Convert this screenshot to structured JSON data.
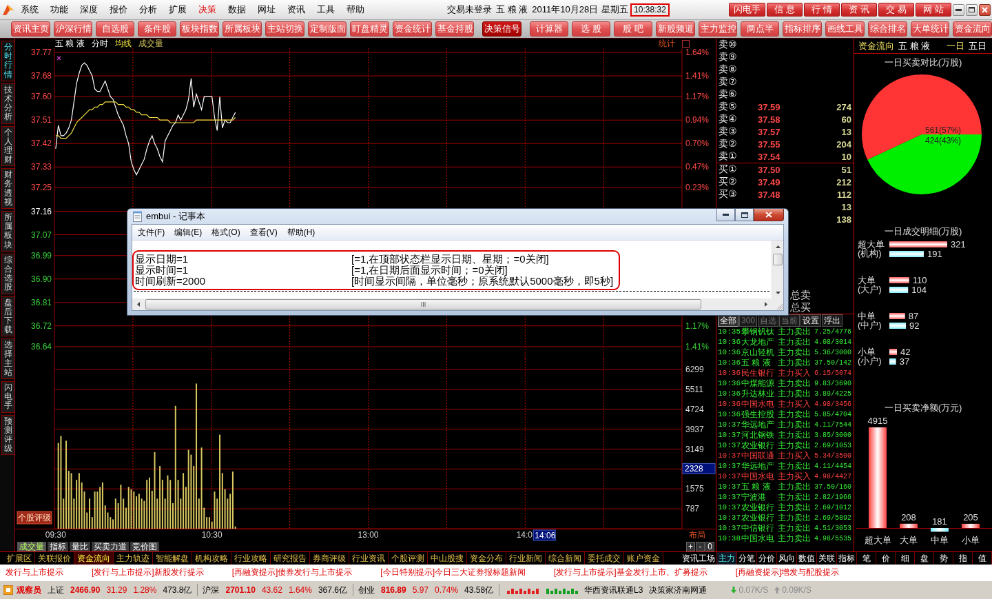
{
  "menu_bar": {
    "items": [
      {
        "label": "系统",
        "selected": false
      },
      {
        "label": "功能",
        "selected": false
      },
      {
        "label": "深度",
        "selected": false
      },
      {
        "label": "报价",
        "selected": false
      },
      {
        "label": "分析",
        "selected": false
      },
      {
        "label": "扩展",
        "selected": false
      },
      {
        "label": "决策",
        "selected": true
      },
      {
        "label": "数据",
        "selected": false
      },
      {
        "label": "网址",
        "selected": false
      },
      {
        "label": "资讯",
        "selected": false
      },
      {
        "label": "工具",
        "selected": false
      },
      {
        "label": "帮助",
        "selected": false
      }
    ],
    "login_status": "交易未登录",
    "stock": "五 粮 液",
    "date": "2011年10月28日",
    "weekday": "星期五",
    "clock": "10:38:32",
    "clock_highlighted": true,
    "buttons": [
      "闪电手",
      "信 息",
      "行 情",
      "资 讯",
      "交 易",
      "网 站"
    ]
  },
  "toolbar": [
    {
      "label": "资讯主页",
      "selected": false
    },
    {
      "label": "沪深行情",
      "selected": false
    },
    {
      "label": "自选股",
      "selected": false
    },
    {
      "label": "条件股",
      "selected": false
    },
    {
      "label": "板块指数",
      "selected": false
    },
    {
      "label": "所属板块",
      "selected": false
    },
    {
      "label": "主站切换",
      "selected": false
    },
    {
      "label": "定制版面",
      "selected": false
    },
    {
      "label": "盯盘精灵",
      "selected": false
    },
    {
      "label": "资金统计",
      "selected": false
    },
    {
      "label": "基金持股",
      "selected": false
    },
    {
      "label": "决策信号",
      "selected": true
    },
    {
      "label": "计算器",
      "selected": false
    },
    {
      "label": "选 股",
      "selected": false
    },
    {
      "label": "股 吧",
      "selected": false
    },
    {
      "label": "新股频道",
      "selected": false
    },
    {
      "label": "主力监控",
      "selected": false
    },
    {
      "label": "两点半",
      "selected": false
    },
    {
      "label": "指标排序",
      "selected": false
    },
    {
      "label": "画线工具",
      "selected": false
    },
    {
      "label": "综合排名",
      "selected": false
    },
    {
      "label": "大单统计",
      "selected": false
    },
    {
      "label": "资金流向",
      "selected": false
    }
  ],
  "side_tabs": [
    {
      "label": "分时行情",
      "selected": true
    },
    {
      "label": "技术分析",
      "selected": false
    },
    {
      "label": "个人理财",
      "selected": false
    },
    {
      "label": "财务透视",
      "selected": false
    },
    {
      "label": "所属板块",
      "selected": false
    },
    {
      "label": "综合选股",
      "selected": false
    },
    {
      "label": "盘后下载",
      "selected": false
    },
    {
      "label": "选择主站",
      "selected": false
    },
    {
      "label": "闪电手",
      "selected": false
    },
    {
      "label": "预测评级",
      "selected": false
    }
  ],
  "chart": {
    "stock": "五 粮 液",
    "stats_label": "统计",
    "price_chart": {
      "chart_data": {
        "type": "line",
        "grid": true,
        "categories": [
          null,
          null,
          null,
          null,
          null,
          null,
          null,
          null,
          null,
          null,
          null,
          null,
          null,
          null,
          null,
          null,
          null,
          null,
          null,
          null,
          null,
          null,
          null,
          null,
          null,
          null,
          null,
          null,
          null,
          null,
          null,
          null,
          null,
          null,
          null,
          null,
          null,
          null,
          null,
          null,
          null,
          null,
          null,
          null,
          null,
          null,
          null,
          null,
          null,
          null,
          null,
          null,
          null,
          null,
          null,
          null,
          null,
          null,
          null,
          null,
          null,
          null,
          null,
          null,
          null,
          null,
          null,
          null,
          null,
          null,
          null,
          null,
          null,
          null,
          null,
          null,
          null,
          null,
          null,
          null,
          null,
          null,
          null,
          null,
          null,
          null,
          null,
          null,
          null,
          null,
          null,
          null,
          null,
          null,
          null,
          null,
          null,
          null,
          null,
          null,
          null,
          null,
          null,
          null,
          null,
          null,
          null,
          null,
          null,
          null,
          null,
          null,
          null,
          null,
          null,
          null,
          null,
          null,
          null,
          null,
          null,
          null,
          null,
          null,
          null,
          null,
          null,
          null,
          null,
          null,
          null,
          null,
          null,
          null,
          null,
          null,
          null,
          null,
          null,
          null,
          null,
          null,
          null,
          null,
          null,
          null,
          null,
          null,
          null,
          null,
          null,
          null,
          null,
          null,
          null,
          null,
          null,
          null,
          null,
          null,
          null,
          null,
          null,
          null,
          null,
          null,
          null,
          null,
          null,
          null,
          null,
          null,
          null,
          null,
          null,
          null,
          null,
          null,
          null,
          null,
          null,
          null,
          null,
          null,
          null,
          null,
          null,
          null,
          null,
          null,
          null,
          null,
          null,
          null,
          null,
          null,
          null,
          null,
          null,
          null,
          null,
          null,
          null,
          null,
          null,
          null,
          null,
          null,
          null,
          null,
          null,
          null,
          null,
          null,
          null,
          null,
          null,
          null,
          null,
          null,
          null,
          null,
          null,
          null,
          null,
          null,
          null,
          null,
          null,
          null,
          null,
          null,
          null,
          null,
          null,
          null,
          null,
          null,
          null,
          null,
          null
        ],
        "series": [
          {
            "name": "分时",
            "color": "#ffffff",
            "values": [
              37.4,
              37.49,
              37.45,
              37.45,
              37.46,
              37.48,
              37.51,
              37.58,
              37.65,
              37.69,
              37.72,
              37.73,
              37.72,
              37.7,
              37.68,
              37.63,
              37.62,
              37.62,
              37.64,
              37.66,
              37.63,
              37.6,
              37.59,
              37.56,
              37.53,
              37.51,
              37.49,
              37.45,
              37.42,
              37.35,
              37.32,
              37.3,
              37.32,
              37.34,
              37.36,
              37.4,
              37.43,
              37.45,
              37.42,
              37.4,
              37.37,
              37.35,
              37.43,
              37.45,
              37.47,
              37.49,
              37.5,
              37.53,
              37.51,
              37.53,
              37.55,
              37.59,
              37.67,
              37.56,
              37.61,
              37.58,
              37.55,
              37.6,
              37.6,
              37.6,
              37.6,
              37.52,
              37.47,
              37.6,
              37.48,
              37.51,
              37.5,
              37.5,
              37.52,
              37.54,
              null,
              null,
              null,
              null,
              null,
              null,
              null,
              null,
              null,
              null,
              null,
              null,
              null,
              null,
              null,
              null,
              null,
              null,
              null,
              null,
              null,
              null,
              null,
              null,
              null,
              null,
              null,
              null,
              null,
              null,
              null,
              null,
              null,
              null,
              null,
              null,
              null,
              null,
              null,
              null,
              null,
              null,
              null,
              null,
              null,
              null,
              null,
              null,
              null,
              null,
              null,
              null,
              null,
              null,
              null,
              null,
              null,
              null,
              null,
              null,
              null,
              null,
              null,
              null,
              null,
              null,
              null,
              null,
              null,
              null,
              null,
              null,
              null,
              null,
              null,
              null,
              null,
              null,
              null,
              null,
              null,
              null,
              null,
              null,
              null,
              null,
              null,
              null,
              null,
              null,
              null,
              null,
              null,
              null,
              null,
              null,
              null,
              null,
              null,
              null,
              null,
              null,
              null,
              null,
              null,
              null,
              null,
              null,
              null,
              null,
              null,
              null,
              null,
              null,
              null,
              null,
              null,
              null,
              null,
              null,
              null,
              null,
              null,
              null,
              null,
              null,
              null,
              null,
              null,
              null,
              null,
              null,
              null,
              null,
              null,
              null,
              null,
              null,
              null,
              null,
              null,
              null,
              null,
              null,
              null,
              null,
              null,
              null,
              null,
              null,
              null,
              null,
              null,
              null,
              null,
              null,
              null,
              null,
              null,
              null,
              null,
              null,
              null,
              null,
              null,
              null,
              null,
              null,
              null,
              null,
              null
            ]
          },
          {
            "name": "均线",
            "color": "#f0e040",
            "values": [
              37.45,
              37.45,
              37.44,
              37.44,
              37.44,
              37.45,
              37.46,
              37.48,
              37.5,
              37.51,
              37.52,
              37.53,
              37.54,
              37.55,
              37.55,
              37.56,
              37.56,
              37.57,
              37.57,
              37.58,
              37.58,
              37.58,
              37.58,
              37.58,
              37.57,
              37.57,
              37.57,
              37.56,
              37.56,
              37.55,
              37.55,
              37.54,
              37.54,
              37.53,
              37.53,
              37.53,
              37.52,
              37.52,
              37.52,
              37.52,
              37.51,
              37.51,
              37.51,
              37.51,
              37.5,
              37.5,
              37.5,
              37.5,
              37.5,
              37.5,
              37.5,
              37.5,
              37.5,
              37.5,
              37.51,
              37.51,
              37.51,
              37.51,
              37.51,
              37.51,
              37.51,
              37.51,
              37.51,
              37.51,
              37.51,
              37.51,
              37.51,
              37.51,
              37.51,
              37.52,
              null,
              null,
              null,
              null,
              null,
              null,
              null,
              null,
              null,
              null,
              null,
              null,
              null,
              null,
              null,
              null,
              null,
              null,
              null,
              null,
              null,
              null,
              null,
              null,
              null,
              null,
              null,
              null,
              null,
              null,
              null,
              null,
              null,
              null,
              null,
              null,
              null,
              null,
              null,
              null,
              null,
              null,
              null,
              null,
              null,
              null,
              null,
              null,
              null,
              null,
              null,
              null,
              null,
              null,
              null,
              null,
              null,
              null,
              null,
              null,
              null,
              null,
              null,
              null,
              null,
              null,
              null,
              null,
              null,
              null,
              null,
              null,
              null,
              null,
              null,
              null,
              null,
              null,
              null,
              null,
              null,
              null,
              null,
              null,
              null,
              null,
              null,
              null,
              null,
              null,
              null,
              null,
              null,
              null,
              null,
              null,
              null,
              null,
              null,
              null,
              null,
              null,
              null,
              null,
              null,
              null,
              null,
              null,
              null,
              null,
              null,
              null,
              null,
              null,
              null,
              null,
              null,
              null,
              null,
              null,
              null,
              null,
              null,
              null,
              null,
              null,
              null,
              null,
              null,
              null,
              null,
              null,
              null,
              null,
              null,
              null,
              null,
              null,
              null,
              null,
              null,
              null,
              null,
              null,
              null,
              null,
              null,
              null,
              null,
              null,
              null,
              null,
              null,
              null,
              null,
              null,
              null,
              null,
              null,
              null,
              null,
              null,
              null,
              null,
              null,
              null,
              null,
              null,
              null,
              null,
              null
            ]
          }
        ],
        "ylim": [
          36.64,
          37.77
        ],
        "yticks": [
          37.77,
          37.68,
          {
            "value": 37.6,
            "label": "37.60"
          },
          37.51,
          37.42,
          37.33,
          37.25,
          37.16,
          37.07,
          36.99,
          {
            "value": 36.9,
            "label": "36.90"
          },
          36.81,
          36.72,
          36.64
        ]
      }
    },
    "percent_labels_upper": [
      "1.64%",
      "1.41%",
      "1.17%",
      "0.94%",
      "0.70%",
      "0.47%",
      "0.23%"
    ],
    "percent_labels_lower": [
      "1.17%",
      "1.41%"
    ],
    "volume_chart": {
      "chart_data": {
        "type": "bar",
        "grid": true,
        "categories": [
          "09:30",
          null,
          null,
          null,
          null,
          null,
          null,
          null,
          null,
          null,
          null,
          null,
          null,
          null,
          null,
          null,
          null,
          null,
          null,
          null,
          null,
          null,
          null,
          null,
          null,
          null,
          null,
          null,
          null,
          null,
          null,
          null,
          null,
          null,
          null,
          null,
          null,
          null,
          null,
          null,
          null,
          null,
          null,
          null,
          null,
          null,
          null,
          null,
          null,
          null,
          null,
          null,
          null,
          null,
          null,
          null,
          null,
          null,
          null,
          null,
          "10:30",
          null,
          null,
          null,
          null,
          null,
          null,
          null,
          null,
          null,
          null,
          null,
          null,
          null,
          null,
          null,
          null,
          null,
          null,
          null,
          null,
          null,
          null,
          null,
          null,
          null,
          null,
          null,
          null,
          null,
          null,
          null,
          null,
          null,
          null,
          null,
          null,
          null,
          null,
          null,
          null,
          null,
          null,
          null,
          null,
          null,
          null,
          null,
          null,
          null,
          null,
          null,
          null,
          null,
          null,
          null,
          null,
          null,
          null,
          null,
          "13:00",
          null,
          null,
          null,
          null,
          null,
          null,
          null,
          null,
          null,
          null,
          null,
          null,
          null,
          null,
          null,
          null,
          null,
          null,
          null,
          null,
          null,
          null,
          null,
          null,
          null,
          null,
          null,
          null,
          null,
          null,
          null,
          null,
          null,
          null,
          null,
          null,
          null,
          null,
          null,
          null,
          null,
          null,
          null,
          null,
          null,
          null,
          null,
          null,
          null,
          null,
          null,
          null,
          null,
          null,
          null,
          null,
          null,
          null,
          null,
          "14:0",
          null,
          null,
          null,
          null,
          null,
          null,
          null,
          null,
          null,
          null,
          null,
          null,
          null,
          null,
          null,
          null,
          null,
          null,
          null,
          null,
          null,
          null,
          null,
          null,
          null,
          null,
          null,
          null,
          null,
          null,
          null,
          null,
          null,
          null,
          null,
          null,
          null,
          null,
          null,
          null,
          null,
          null,
          null,
          null,
          null,
          null,
          null,
          null,
          null,
          null,
          null,
          null,
          null,
          null,
          null,
          null,
          null,
          null,
          null,
          null
        ],
        "series": [
          {
            "name": "成交量",
            "color": "#d8c860",
            "values": [
              null,
              3390,
              3670,
              1190,
              3480,
              2290,
              2200,
              1190,
              1930,
              2200,
              1830,
              1470,
              640,
              1190,
              460,
              1470,
              1470,
              1650,
              1830,
              920,
              640,
              460,
              370,
              1190,
              1010,
              1740,
              1190,
              830,
              1650,
              1560,
              1470,
              1280,
              1380,
              1190,
              1100,
              1930,
              2020,
              1500,
              3030,
              1190,
              2480,
              1930,
              1190,
              2110,
              1930,
              1010,
              4860,
              1930,
              1190,
              2200,
              1650,
              3120,
              2930,
              2480,
              5740,
              1190,
              3210,
              830,
              460,
              460,
              280,
              1470,
              1190,
              3720,
              2200,
              1560,
              1190,
              1380,
              2260,
              90,
              null,
              null,
              null,
              null,
              null,
              null,
              null,
              null,
              null,
              null,
              null,
              null,
              null,
              null,
              null,
              null,
              null,
              null,
              null,
              null,
              null,
              null,
              null,
              null,
              null,
              null,
              null,
              null,
              null,
              null,
              null,
              null,
              null,
              null,
              null,
              null,
              null,
              null,
              null,
              null,
              null,
              null,
              null,
              null,
              null,
              null,
              null,
              null,
              null,
              null,
              null,
              null,
              null,
              null,
              null,
              null,
              null,
              null,
              null,
              null,
              null,
              null,
              null,
              null,
              null,
              null,
              null,
              null,
              null,
              null,
              null,
              null,
              null,
              null,
              null,
              null,
              null,
              null,
              null,
              null,
              null,
              null,
              null,
              null,
              null,
              null,
              null,
              null,
              null,
              null,
              null,
              null,
              null,
              null,
              null,
              null,
              null,
              null,
              null,
              null,
              null,
              null,
              null,
              null,
              null,
              null,
              null,
              null,
              null,
              null,
              null,
              null,
              null,
              null,
              null,
              null,
              null,
              null,
              null,
              null,
              null,
              null,
              null,
              null,
              null,
              null,
              null,
              null,
              null,
              null,
              null,
              null,
              null,
              null,
              null,
              null,
              null,
              null,
              null,
              null,
              null,
              null,
              null,
              null,
              null,
              null,
              null,
              null,
              null,
              null,
              null,
              null,
              null,
              null,
              null,
              null,
              null,
              null,
              null,
              null,
              null,
              null,
              null,
              null,
              null,
              null,
              null,
              null,
              null,
              null,
              null
            ]
          }
        ],
        "ylim": [
          0,
          6299
        ],
        "yticks": [
          787,
          1575,
          3149,
          3937,
          4724,
          5511,
          6299
        ]
      }
    },
    "cursor_time": "14:06",
    "cursor_volume": "2328",
    "layout_label": "布局",
    "rating_button": "个股评级",
    "bottom_tabs": [
      {
        "label": "成交量",
        "selected": true
      },
      {
        "label": "指标",
        "selected": false
      },
      {
        "label": "量比",
        "selected": false
      },
      {
        "label": "买卖力道",
        "selected": false
      },
      {
        "label": "竞价图",
        "selected": false
      }
    ],
    "zoom_buttons": [
      "+",
      "-",
      "0"
    ]
  },
  "order_book": {
    "asks": [
      {
        "label": "卖⑩"
      },
      {
        "label": "卖⑨"
      },
      {
        "label": "卖⑧"
      },
      {
        "label": "卖⑦"
      },
      {
        "label": "卖⑥"
      },
      {
        "label": "卖⑤",
        "price": "37.59",
        "volume": "274"
      },
      {
        "label": "卖④",
        "price": "37.58",
        "volume": "60"
      },
      {
        "label": "卖③",
        "price": "37.57",
        "volume": "13"
      },
      {
        "label": "卖②",
        "price": "37.55",
        "volume": "204"
      },
      {
        "label": "卖①",
        "price": "37.54",
        "volume": "10"
      }
    ],
    "bids": [
      {
        "label": "买①",
        "price": "37.50",
        "volume": "51"
      },
      {
        "label": "买②",
        "price": "37.49",
        "volume": "212"
      },
      {
        "label": "买③",
        "price": "37.48",
        "volume": "112"
      },
      {
        "volume": "13"
      },
      {
        "volume": "138"
      }
    ],
    "totals": [
      "总卖",
      "总买"
    ]
  },
  "trades": {
    "tabs": [
      {
        "label": "全部",
        "selected": true,
        "disabled": false
      },
      {
        "label": "300",
        "selected": false,
        "disabled": true
      },
      {
        "label": "自选",
        "selected": false,
        "disabled": true
      },
      {
        "label": "当前",
        "selected": false,
        "disabled": true
      },
      {
        "label": "设置",
        "selected": false,
        "disabled": false
      },
      {
        "label": "浮出",
        "selected": false,
        "disabled": false
      }
    ],
    "rows": [
      {
        "time": "10:35",
        "name": "攀钢钒钛",
        "action": "主力卖出",
        "detail": "7.25/4776",
        "kind": "sell"
      },
      {
        "time": "10:36",
        "name": "大龙地产",
        "action": "主力卖出",
        "detail": "4.08/3014",
        "kind": "sell"
      },
      {
        "time": "10:36",
        "name": "京山轻机",
        "action": "主力卖出",
        "detail": "5.36/3000",
        "kind": "sell"
      },
      {
        "time": "10:36",
        "name": "五 粮 液",
        "action": "主力卖出",
        "detail": "37.50/142",
        "kind": "sell"
      },
      {
        "time": "10:36",
        "name": "民生银行",
        "action": "主力买入",
        "detail": "6.15/5074",
        "kind": "buy"
      },
      {
        "time": "10:36",
        "name": "中煤能源",
        "action": "主力卖出",
        "detail": "9.83/3690",
        "kind": "sell"
      },
      {
        "time": "10:36",
        "name": "升达林业",
        "action": "主力卖出",
        "detail": "3.89/4225",
        "kind": "sell"
      },
      {
        "time": "10:36",
        "name": "中国水电",
        "action": "主力买入",
        "detail": "4.98/3456",
        "kind": "buy"
      },
      {
        "time": "10:36",
        "name": "强生控股",
        "action": "主力卖出",
        "detail": "5.85/4704",
        "kind": "sell"
      },
      {
        "time": "10:37",
        "name": "华远地产",
        "action": "主力卖出",
        "detail": "4.11/7544",
        "kind": "sell"
      },
      {
        "time": "10:37",
        "name": "河北钢铁",
        "action": "主力卖出",
        "detail": "3.85/3000",
        "kind": "sell"
      },
      {
        "time": "10:37",
        "name": "农业银行",
        "action": "主力卖出",
        "detail": "2.69/1053",
        "kind": "sell"
      },
      {
        "time": "10:37",
        "name": "中国联通",
        "action": "主力买入",
        "detail": "5.34/3500",
        "kind": "buy"
      },
      {
        "time": "10:37",
        "name": "华远地产",
        "action": "主力卖出",
        "detail": "4.11/4454",
        "kind": "sell"
      },
      {
        "time": "10:37",
        "name": "中国水电",
        "action": "主力买入",
        "detail": "4.98/4427",
        "kind": "buy"
      },
      {
        "time": "10:37",
        "name": "五 粮 液",
        "action": "主力卖出",
        "detail": "37.50/160",
        "kind": "sell"
      },
      {
        "time": "10:37",
        "name": "宁波港",
        "action": "主力卖出",
        "detail": "2.82/1966",
        "kind": "sell"
      },
      {
        "time": "10:37",
        "name": "农业银行",
        "action": "主力卖出",
        "detail": "2.69/1012",
        "kind": "sell"
      },
      {
        "time": "10:37",
        "name": "农业银行",
        "action": "主力卖出",
        "detail": "2.69/5892",
        "kind": "sell"
      },
      {
        "time": "10:37",
        "name": "中信银行",
        "action": "主力卖出",
        "detail": "4.51/3053",
        "kind": "sell"
      },
      {
        "time": "10:38",
        "name": "中国水电",
        "action": "主力卖出",
        "detail": "4.98/5535",
        "kind": "sell"
      }
    ]
  },
  "fund_flow": {
    "title": "资金流向",
    "stock": "五 粮 液",
    "periods": [
      {
        "label": "一日",
        "selected": true
      },
      {
        "label": "五日",
        "selected": false
      }
    ],
    "pie": {
      "chart_data": {
        "type": "pie",
        "title": "一日买卖对比(万股)",
        "values": [
          561,
          424
        ],
        "colors": [
          "#ff3535",
          "#00ee00"
        ],
        "value_labels": [
          "561(57%)",
          "424(43%)"
        ]
      }
    },
    "detail": {
      "chart_data": {
        "type": "bar",
        "orientation": "horizontal",
        "title": "一日成交明细(万股)",
        "categories": [
          "超大单\n(机构)",
          "大单\n(大户)",
          "中单\n(中户)",
          "小单\n(小户)"
        ],
        "series": [
          {
            "color": "#ff5a5a",
            "values": [
              321,
              110,
              87,
              42
            ]
          },
          {
            "color": "#7ff0ff",
            "values": [
              191,
              104,
              92,
              37
            ]
          }
        ],
        "data_labels": true
      }
    },
    "net": {
      "chart_data": {
        "type": "bar",
        "title": "一日买卖净额(万元)",
        "categories": [
          "超大单",
          "大单",
          "中单",
          "小单"
        ],
        "values": [
          4915,
          208,
          -181,
          205
        ],
        "colors": [
          "#ff4040",
          "#ff4040",
          "#7ff0ff",
          "#ff4040"
        ],
        "value_labels": [
          "4915",
          "208",
          null,
          "205"
        ],
        "annotations": [
          "181"
        ]
      }
    }
  },
  "function_bar": {
    "items": [
      {
        "label": "扩展区",
        "selected": false
      },
      {
        "label": "关联报价",
        "selected": false
      },
      {
        "label": "资金流向",
        "selected": true
      },
      {
        "label": "主力轨迹",
        "selected": false
      },
      {
        "label": "智能解盘",
        "selected": false
      },
      {
        "label": "机构攻略",
        "selected": false
      },
      {
        "label": "行业攻略",
        "selected": false
      },
      {
        "label": "研究报告",
        "selected": false
      },
      {
        "label": "券商评级",
        "selected": false
      },
      {
        "label": "行业资讯",
        "selected": false
      },
      {
        "label": "个股评测",
        "selected": false
      },
      {
        "label": "中山股搜",
        "selected": false
      },
      {
        "label": "资金分布",
        "selected": false
      },
      {
        "label": "行业新闻",
        "selected": false
      },
      {
        "label": "综合新闻",
        "selected": false
      },
      {
        "label": "委托成交",
        "selected": false
      },
      {
        "label": "账户资金",
        "selected": false
      }
    ],
    "right_items": [
      {
        "label": "资讯工场",
        "selected": false
      },
      {
        "label": "主力",
        "selected": true
      },
      {
        "label": "分笔",
        "selected": false
      },
      {
        "label": "分价",
        "selected": false
      },
      {
        "label": "风向",
        "selected": false
      },
      {
        "label": "数值",
        "selected": false
      },
      {
        "label": "关联",
        "selected": false
      },
      {
        "label": "指标",
        "selected": false
      }
    ],
    "panel_tabs": [
      "笔",
      "价",
      "细",
      "盘",
      "势",
      "指",
      "值"
    ]
  },
  "ticker": [
    "发行与上市提示",
    "[发行与上市提示]新股发行提示",
    "[再融资提示]债券发行与上市提示",
    "[今日特别提示]今日三大证券报标题新闻",
    "[发行与上市提示]基金发行上市、扩募提示",
    "[再融资提示]增发与配股提示"
  ],
  "status_bar": {
    "user": "观察员",
    "indices": [
      {
        "name": "上证",
        "value": "2466.90",
        "change": "31.29",
        "pct": "1.28%",
        "amount": "473.8亿",
        "kind": "up"
      },
      {
        "name": "沪深",
        "value": "2701.10",
        "change": "43.62",
        "pct": "1.64%",
        "amount": "367.6亿",
        "kind": "up"
      },
      {
        "name": "创业",
        "value": "816.89",
        "change": "5.97",
        "pct": "0.74%",
        "amount": "43.58亿",
        "kind": "up"
      }
    ],
    "servers": [
      "华西资讯联通L3",
      "决策家济南网通"
    ],
    "speeds": [
      {
        "text": "0.07K/S",
        "kind": "down"
      },
      {
        "text": "0.09K/S",
        "kind": "up"
      }
    ]
  },
  "notepad": {
    "title": "embui - 记事本",
    "menu": [
      "文件(F)",
      "编辑(E)",
      "格式(O)",
      "查看(V)",
      "帮助(H)"
    ],
    "highlighted": true,
    "lines": [
      {
        "setting": "显示日期=1",
        "note": "[=1,在顶部状态栏显示日期、星期；=0关闭]"
      },
      {
        "setting": "显示时间=1",
        "note": "[=1,在日期后面显示时间；=0关闭]"
      },
      {
        "setting": "时间刷新=2000",
        "note": "[时间显示间隔，单位毫秒；原系统默认5000毫秒，即5秒]"
      }
    ]
  }
}
